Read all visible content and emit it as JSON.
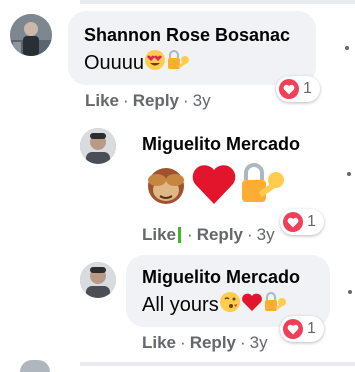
{
  "comments": [
    {
      "author": "Shannon Rose Bosanac",
      "text": "Ouuuu",
      "emojis": [
        "heart-eyes-emoji",
        "lock-key-emoji"
      ],
      "actions": {
        "like": "Like",
        "reply": "Reply",
        "time": "3y",
        "separator": "·"
      },
      "reaction": {
        "icon": "heart-reaction-icon",
        "count": "1"
      }
    },
    {
      "author": "Miguelito Mercado",
      "text": "",
      "emojis": [
        "see-no-evil-monkey-emoji",
        "red-heart-emoji",
        "lock-key-emoji"
      ],
      "actions": {
        "like": "Like",
        "reply": "Reply",
        "time": "3y",
        "separator": "·"
      },
      "reaction": {
        "icon": "heart-reaction-icon",
        "count": "1"
      }
    },
    {
      "author": "Miguelito Mercado",
      "text": "All yours",
      "emojis": [
        "kiss-emoji",
        "red-heart-emoji",
        "lock-key-emoji"
      ],
      "actions": {
        "like": "Like",
        "reply": "Reply",
        "time": "3y",
        "separator": "·"
      },
      "reaction": {
        "icon": "heart-reaction-icon",
        "count": "1"
      }
    }
  ],
  "colors": {
    "bubble": "#f0f2f5",
    "meta_text": "#65676b",
    "heart": "#f33e58",
    "cursor": "#42b72a"
  }
}
